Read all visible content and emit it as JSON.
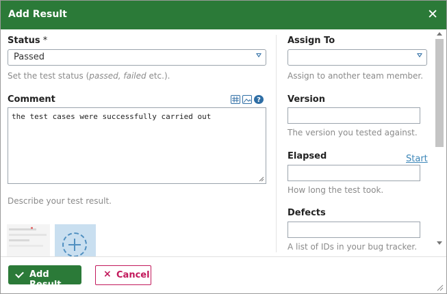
{
  "dialog": {
    "title": "Add Result",
    "close_glyph": "✕"
  },
  "status": {
    "label": "Status",
    "required_mark": " *",
    "selected": "Passed",
    "help_before": "Set the test status (",
    "help_italic": "passed, failed",
    "help_after": " etc.)."
  },
  "comment": {
    "label": "Comment",
    "value": "the test cases were successfully carried out",
    "help": "Describe your test result.",
    "toolbar_icons": [
      "table-icon",
      "image-icon",
      "help-icon"
    ],
    "help_icon_glyph": "?"
  },
  "attachments": {
    "items": [
      "attachment-thumbnail"
    ],
    "add_icon": "plus-circle-icon"
  },
  "assign_to": {
    "label": "Assign To",
    "selected": "",
    "help": "Assign to another team member."
  },
  "version": {
    "label": "Version",
    "value": "",
    "help": "The version you tested against."
  },
  "elapsed": {
    "label": "Elapsed",
    "link": "Start",
    "value": "",
    "help": "How long the test took."
  },
  "defects": {
    "label": "Defects",
    "value": "",
    "help": "A list of IDs in your bug tracker."
  },
  "footer": {
    "add_label": "Add Result",
    "cancel_label": "Cancel",
    "cancel_glyph": "×"
  },
  "colors": {
    "header": "#2b7a38",
    "primary": "#2b7a38",
    "cancel": "#c2185b",
    "link": "#3c86b8"
  }
}
